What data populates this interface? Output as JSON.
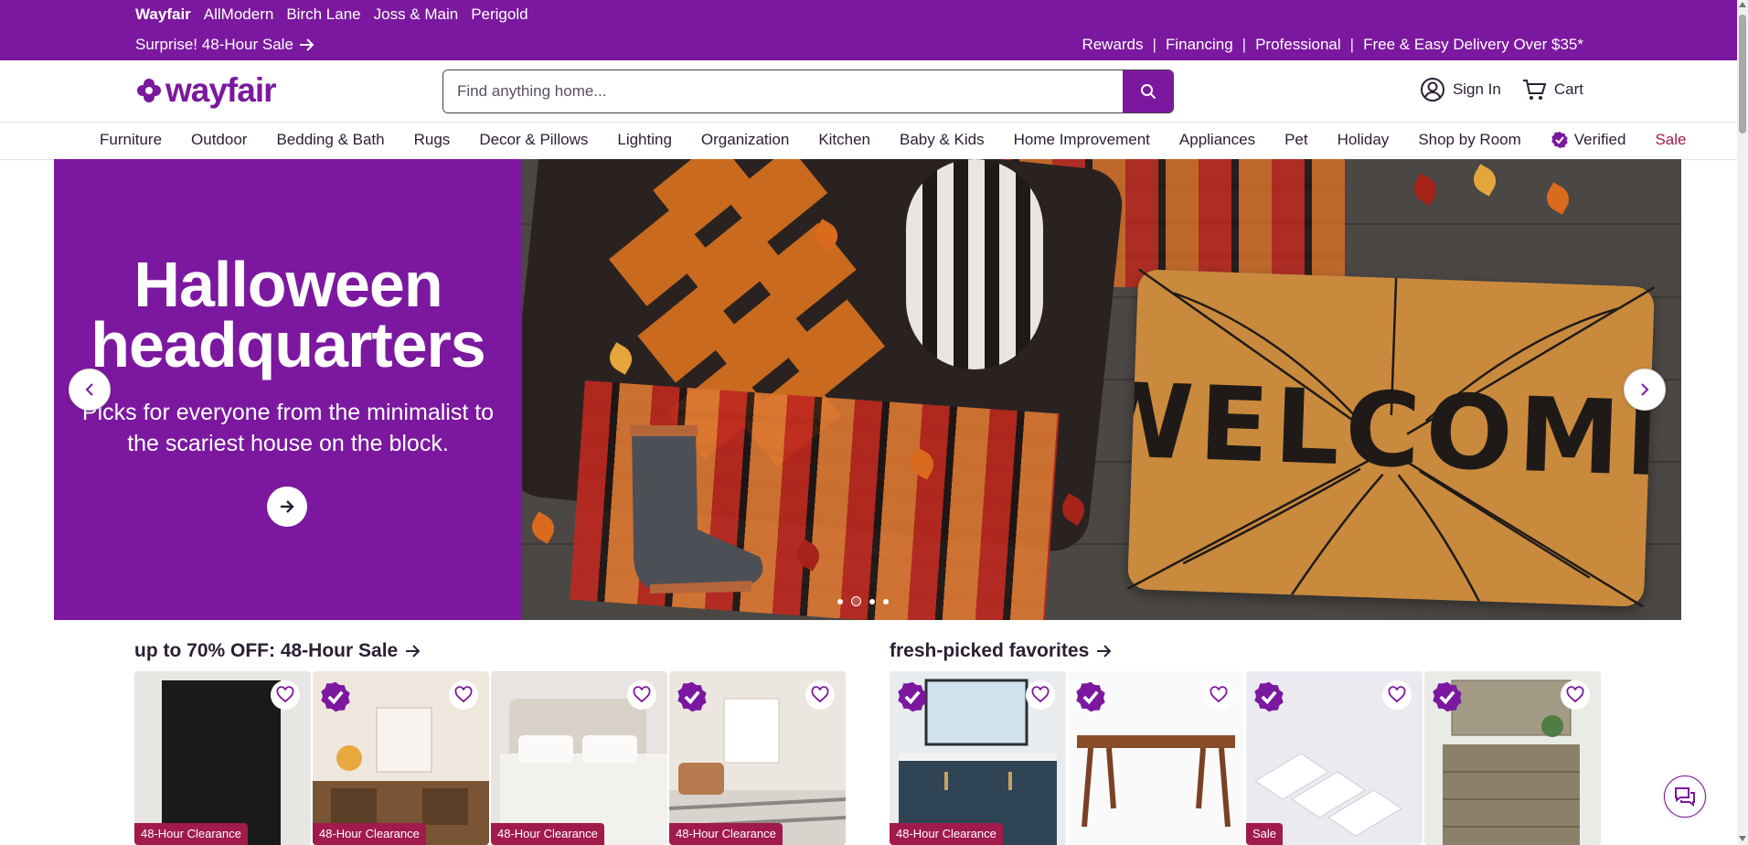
{
  "topbar": {
    "brands": [
      {
        "label": "Wayfair",
        "active": true
      },
      {
        "label": "AllModern",
        "active": false
      },
      {
        "label": "Birch Lane",
        "active": false
      },
      {
        "label": "Joss & Main",
        "active": false
      },
      {
        "label": "Perigold",
        "active": false
      }
    ],
    "promo_label": "Surprise! 48-Hour Sale",
    "utility_links": [
      "Rewards",
      "Financing",
      "Professional",
      "Free & Easy Delivery Over $35*"
    ]
  },
  "header": {
    "logo_text": "wayfair",
    "search_placeholder": "Find anything home...",
    "sign_in_label": "Sign In",
    "cart_label": "Cart"
  },
  "nav": {
    "items": [
      "Furniture",
      "Outdoor",
      "Bedding & Bath",
      "Rugs",
      "Decor & Pillows",
      "Lighting",
      "Organization",
      "Kitchen",
      "Baby & Kids",
      "Home Improvement",
      "Appliances",
      "Pet",
      "Holiday",
      "Shop by Room"
    ],
    "verified_label": "Verified",
    "sale_label": "Sale"
  },
  "hero": {
    "title_line1": "Halloween",
    "title_line2": "headquarters",
    "subtitle": "Picks for everyone from the minimalist to the scariest house on the block.",
    "mat_text": "WELCOME",
    "slide_count": 4,
    "active_slide": 2
  },
  "sections": {
    "left_title": "up to 70% OFF: 48-Hour Sale",
    "right_title": "fresh-picked favorites"
  },
  "cards": [
    {
      "tag": "48-Hour Clearance",
      "verified": false,
      "scene": "black-art"
    },
    {
      "tag": "48-Hour Clearance",
      "verified": true,
      "scene": "console"
    },
    {
      "tag": "48-Hour Clearance",
      "verified": false,
      "scene": "bed"
    },
    {
      "tag": "48-Hour Clearance",
      "verified": true,
      "scene": "living-rug"
    },
    {
      "tag": "48-Hour Clearance",
      "verified": true,
      "scene": "vanity"
    },
    {
      "tag": "",
      "verified": true,
      "scene": "table"
    },
    {
      "tag": "Sale",
      "verified": true,
      "scene": "loungers"
    },
    {
      "tag": "",
      "verified": true,
      "scene": "dresser"
    }
  ],
  "colors": {
    "brand_purple": "#7b189f",
    "sale_red": "#a11a4c"
  }
}
